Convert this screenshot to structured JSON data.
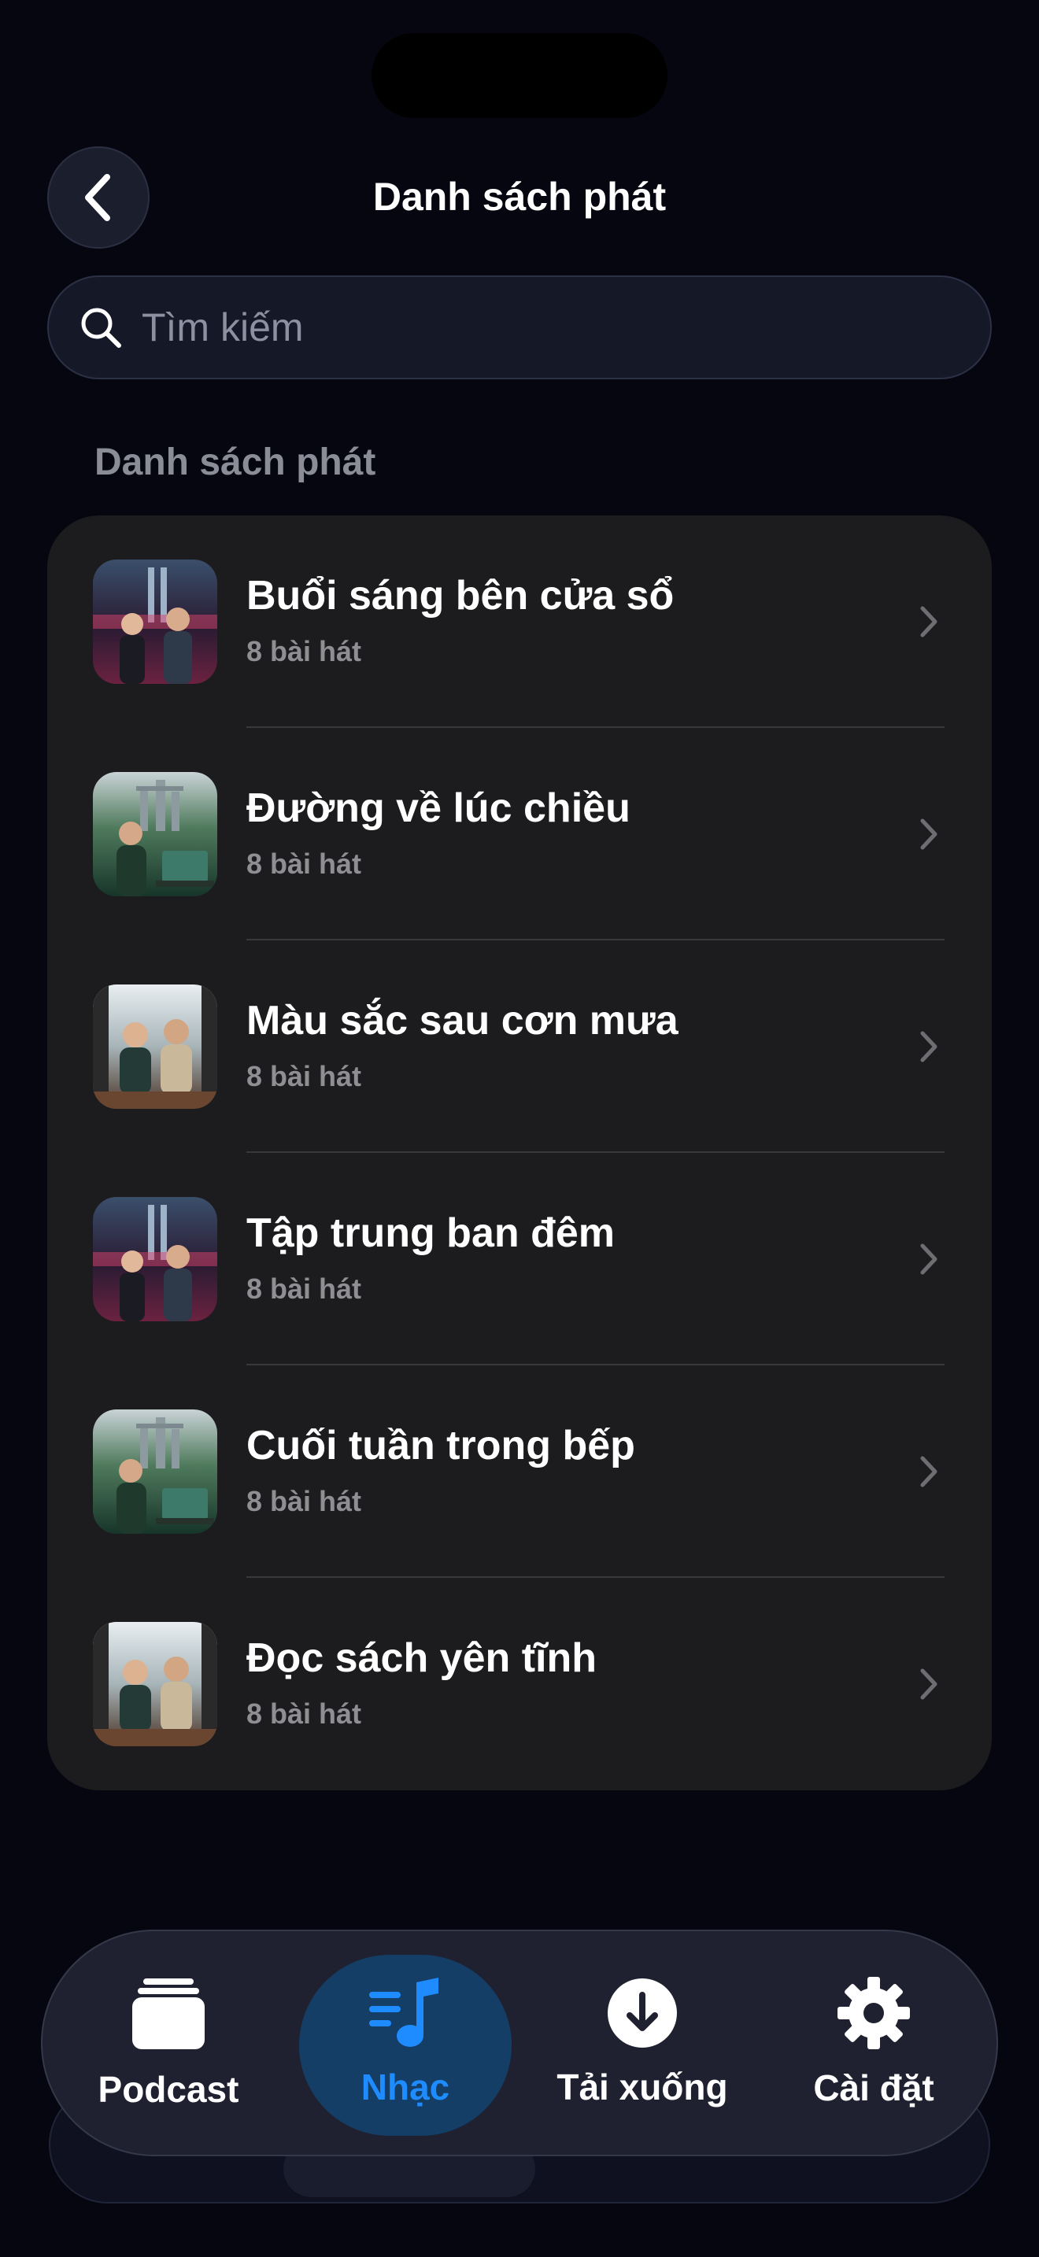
{
  "header": {
    "title": "Danh sách phát",
    "back_icon": "chevron-left-icon"
  },
  "search": {
    "placeholder": "Tìm kiếm",
    "icon": "search-icon"
  },
  "section": {
    "label": "Danh sách phát"
  },
  "playlists": [
    {
      "title": "Buổi sáng bên cửa sổ",
      "count": "8 bài hát",
      "art": "city-night-duo"
    },
    {
      "title": "Đường về lúc chiều",
      "count": "8 bài hát",
      "art": "garden-woman-laptop"
    },
    {
      "title": "Màu sắc sau cơn mưa",
      "count": "8 bài hát",
      "art": "cafe-duo-window"
    },
    {
      "title": "Tập trung ban đêm",
      "count": "8 bài hát",
      "art": "city-night-duo"
    },
    {
      "title": "Cuối tuần trong bếp",
      "count": "8 bài hát",
      "art": "garden-woman-laptop"
    },
    {
      "title": "Đọc sách yên tĩnh",
      "count": "8 bài hát",
      "art": "cafe-duo-window"
    }
  ],
  "tabbar": {
    "tabs": [
      {
        "label": "Podcast",
        "icon": "podcast-stack-icon",
        "active": false
      },
      {
        "label": "Nhạc",
        "icon": "music-list-icon",
        "active": true
      },
      {
        "label": "Tải xuống",
        "icon": "download-icon",
        "active": false
      },
      {
        "label": "Cài đặt",
        "icon": "gear-icon",
        "active": false
      }
    ]
  },
  "colors": {
    "background": "#05060f",
    "card": "#1c1c1e",
    "accent": "#1e8bff",
    "secondary_text": "#8e8e93"
  }
}
